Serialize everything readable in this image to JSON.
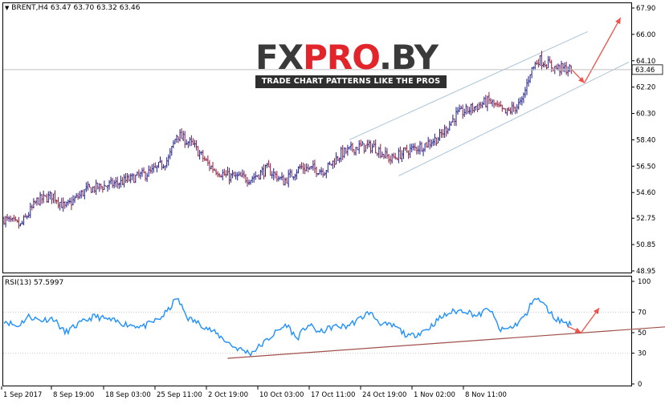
{
  "terminal": {
    "symbol_label": "BRENT,H4",
    "ohlc": "63.47 63.70 63.32 63.46",
    "indicator_label": "RSI(13) 57.5997",
    "current_price": "63.46"
  },
  "logo": {
    "text_prefix": "FX",
    "text_accent": "PRO",
    "text_suffix": ".BY",
    "tagline": "TRADE CHART PATTERNS LIKE THE PROS"
  },
  "colors": {
    "bull_candle": "#1c1c8c",
    "bear_candle": "#8c1c3c",
    "rsi_line": "#1e90ff",
    "trend_line": "#a0504a",
    "channel_line": "#a9c4d8",
    "arrow": "#f0504a",
    "grid": "#c8c8c8"
  },
  "chart_data": [
    {
      "type": "candlestick",
      "title": "BRENT,H4",
      "y_ticks": [
        "67.90",
        "66.00",
        "64.10",
        "62.20",
        "60.30",
        "58.40",
        "56.50",
        "54.60",
        "52.75",
        "50.85",
        "48.95"
      ],
      "ylim": [
        48.95,
        67.9
      ],
      "x_ticks": [
        "1 Sep 2017",
        "8 Sep 19:00",
        "18 Sep 03:00",
        "25 Sep 11:00",
        "2 Oct 19:00",
        "10 Oct 03:00",
        "17 Oct 11:00",
        "24 Oct 19:00",
        "1 Nov 02:00",
        "8 Nov 11:00"
      ],
      "anchors": [
        [
          0,
          52.7
        ],
        [
          10,
          52.2
        ],
        [
          20,
          54.0
        ],
        [
          30,
          54.4
        ],
        [
          37,
          53.5
        ],
        [
          50,
          54.8
        ],
        [
          70,
          55.3
        ],
        [
          90,
          56.1
        ],
        [
          100,
          57.0
        ],
        [
          105,
          58.8
        ],
        [
          115,
          58.0
        ],
        [
          125,
          56.5
        ],
        [
          135,
          55.8
        ],
        [
          150,
          55.6
        ],
        [
          160,
          56.3
        ],
        [
          170,
          55.4
        ],
        [
          180,
          56.4
        ],
        [
          195,
          56.2
        ],
        [
          205,
          57.4
        ],
        [
          215,
          57.9
        ],
        [
          225,
          57.9
        ],
        [
          235,
          57.0
        ],
        [
          245,
          57.6
        ],
        [
          255,
          58.0
        ],
        [
          265,
          58.6
        ],
        [
          275,
          60.2
        ],
        [
          285,
          60.7
        ],
        [
          295,
          61.2
        ],
        [
          305,
          60.3
        ],
        [
          315,
          61.1
        ],
        [
          320,
          63.3
        ],
        [
          325,
          64.2
        ],
        [
          335,
          63.6
        ],
        [
          345,
          63.46
        ]
      ],
      "channel": {
        "upper": [
          [
            210,
            58.4
          ],
          [
            355,
            66.2
          ]
        ],
        "lower": [
          [
            240,
            55.8
          ],
          [
            380,
            64.0
          ]
        ]
      },
      "arrows": [
        {
          "from": [
            345,
            63.5
          ],
          "to": [
            353,
            62.5
          ]
        },
        {
          "from": [
            353,
            62.5
          ],
          "to": [
            375,
            67.2
          ]
        }
      ]
    },
    {
      "type": "line",
      "title": "RSI(13) 57.5997",
      "y_ticks": [
        "100",
        "70",
        "50",
        "30",
        "0"
      ],
      "ylim": [
        0,
        100
      ],
      "anchors": [
        [
          0,
          62
        ],
        [
          8,
          56
        ],
        [
          15,
          66
        ],
        [
          22,
          62
        ],
        [
          30,
          64
        ],
        [
          37,
          50
        ],
        [
          45,
          58
        ],
        [
          55,
          66
        ],
        [
          65,
          62
        ],
        [
          75,
          58
        ],
        [
          85,
          56
        ],
        [
          95,
          64
        ],
        [
          100,
          72
        ],
        [
          105,
          84
        ],
        [
          112,
          64
        ],
        [
          120,
          58
        ],
        [
          130,
          48
        ],
        [
          140,
          36
        ],
        [
          150,
          30
        ],
        [
          158,
          40
        ],
        [
          165,
          50
        ],
        [
          172,
          58
        ],
        [
          178,
          44
        ],
        [
          185,
          58
        ],
        [
          192,
          50
        ],
        [
          200,
          56
        ],
        [
          208,
          56
        ],
        [
          215,
          62
        ],
        [
          222,
          70
        ],
        [
          230,
          58
        ],
        [
          238,
          56
        ],
        [
          246,
          46
        ],
        [
          250,
          48
        ],
        [
          258,
          54
        ],
        [
          265,
          64
        ],
        [
          272,
          70
        ],
        [
          280,
          72
        ],
        [
          288,
          66
        ],
        [
          295,
          74
        ],
        [
          302,
          52
        ],
        [
          310,
          56
        ],
        [
          318,
          68
        ],
        [
          322,
          84
        ],
        [
          327,
          80
        ],
        [
          335,
          64
        ],
        [
          345,
          57.6
        ]
      ],
      "trend_line": [
        [
          136,
          25
        ],
        [
          414,
          57
        ]
      ],
      "arrows": [
        {
          "from": [
            343,
            56
          ],
          "to": [
            351,
            50
          ]
        },
        {
          "from": [
            351,
            50
          ],
          "to": [
            362,
            74
          ]
        }
      ]
    }
  ]
}
